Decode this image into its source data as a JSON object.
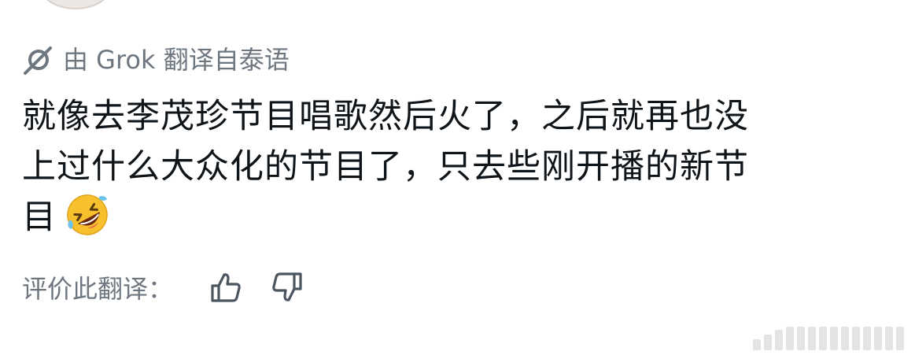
{
  "translation_notice": {
    "icon": "grok-icon",
    "text": "由 Grok 翻译自泰语"
  },
  "post": {
    "lines": [
      "就像去李茂珍节目唱歌然后火了，之后就再也没",
      "上过什么大众化的节目了，只去些刚开播的新节",
      "目"
    ],
    "emoji": "rolling-on-floor-laughing-emoji"
  },
  "rating": {
    "label": "评价此翻译：",
    "thumbs_up_icon": "thumbs-up-icon",
    "thumbs_down_icon": "thumbs-down-icon"
  },
  "colors": {
    "text_primary": "#0f1419",
    "text_secondary": "#6e7780",
    "background": "#ffffff"
  }
}
